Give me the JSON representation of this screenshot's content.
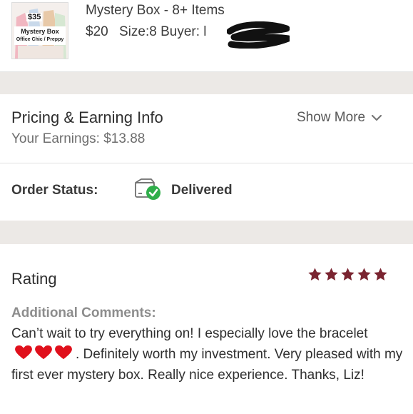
{
  "item": {
    "thumbnail": {
      "price_tag": "$35",
      "box_name_line1": "Mystery Box",
      "box_name_line2": "Office Chic / Preppy"
    },
    "title": "Mystery Box - 8+ Items",
    "price": "$20",
    "size": "Size:8",
    "buyer_label": "Buyer: l",
    "buyer_name_redacted": true
  },
  "pricing": {
    "title": "Pricing & Earning Info",
    "earnings": "Your Earnings: $13.88",
    "show_more_label": "Show More"
  },
  "order_status": {
    "label": "Order Status:",
    "value": "Delivered",
    "icon": "package-delivered-icon"
  },
  "rating": {
    "title": "Rating",
    "stars": 5,
    "max_stars": 5,
    "star_color": "#7a2430"
  },
  "comments": {
    "label": "Additional Comments:",
    "text_before_hearts": "Can’t wait to try everything on! I especially love the bracelet",
    "hearts_count": 3,
    "heart_color": "#e0101c",
    "text_after_hearts": ". Definitely worth my investment. Very pleased with my first ever mystery box. Really nice experience. Thanks, Liz!"
  },
  "colors": {
    "band": "#ece9e6",
    "delivered_check": "#2fae4a"
  }
}
